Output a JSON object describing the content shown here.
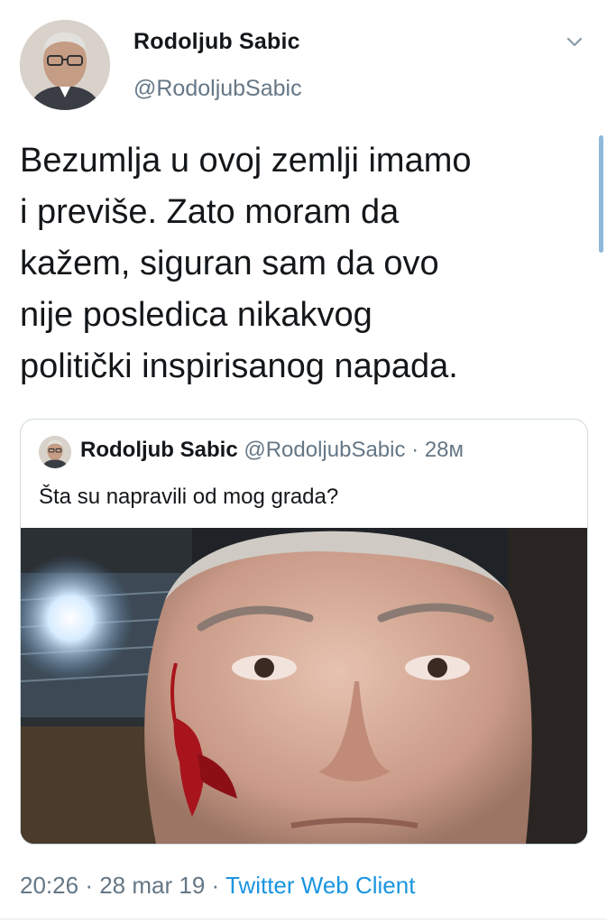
{
  "tweet": {
    "author_name": "Rodoljub Sabic",
    "author_handle": "@RodoljubSabic",
    "text": "Bezumlja u ovoj zemlji imamo\ni previše. Zato moram da\nkažem, siguran sam da ovo\nnije posledica nikakvog\npolitički inspirisanog napada.",
    "icons": {
      "menu": "chevron-down-icon",
      "avatar": "profile-photo"
    }
  },
  "quoted_tweet": {
    "author_name": "Rodoljub Sabic",
    "author_handle": "@RodoljubSabic",
    "separator": "·",
    "time_ago": "28м",
    "text": "Šta su napravili od mog grada?"
  },
  "meta": {
    "time": "20:26",
    "separator": "·",
    "date": "28 mar 19",
    "separator2": "·",
    "client": "Twitter Web Client"
  },
  "colors": {
    "text": "#14171a",
    "secondary": "#657786",
    "link": "#1b95e0",
    "border": "#cfd9de"
  }
}
